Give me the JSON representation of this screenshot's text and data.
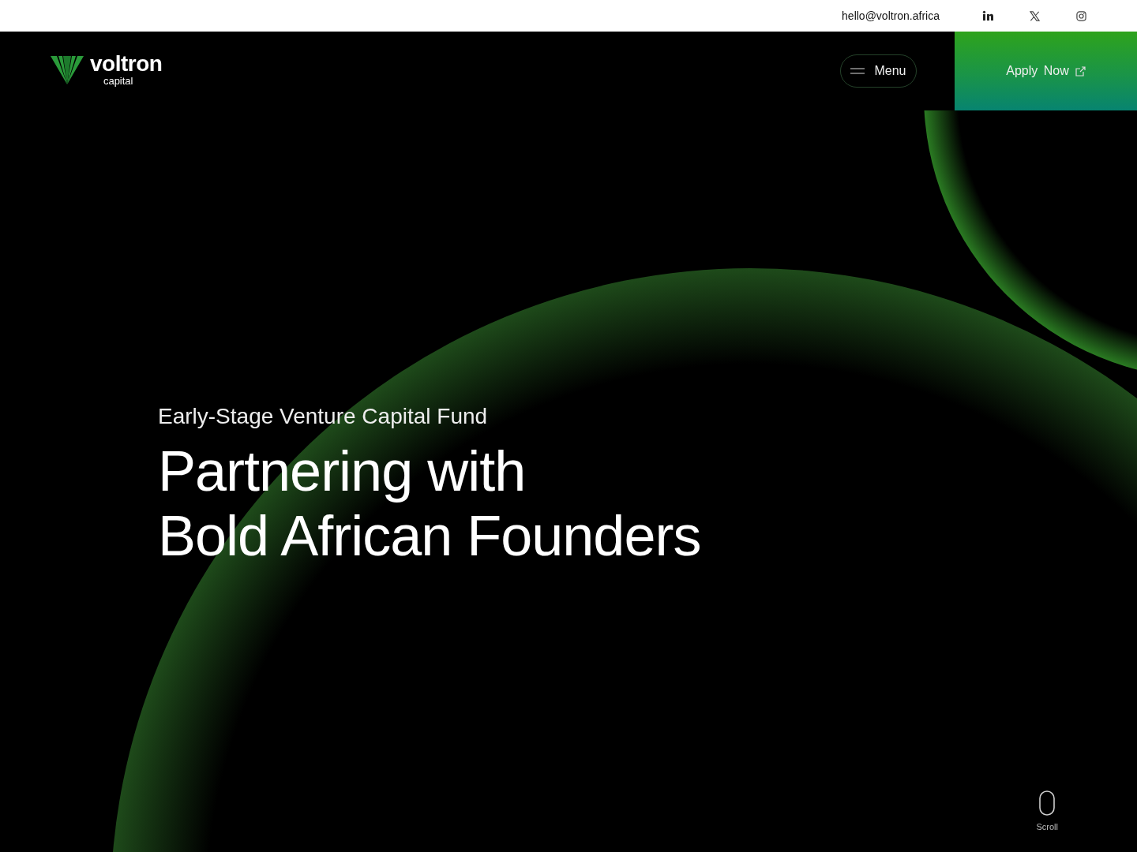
{
  "top_bar": {
    "email": "hello@voltron.africa"
  },
  "header": {
    "logo": {
      "name": "voltron",
      "sub": "capital"
    },
    "menu_button": {
      "label": "Menu"
    },
    "apply_button": {
      "label": "Apply Now"
    }
  },
  "hero": {
    "eyebrow": "Early-Stage Venture Capital Fund",
    "headline_lines": [
      "Partnering with",
      "Bold African Founders"
    ],
    "scroll_hint": "Scroll"
  }
}
